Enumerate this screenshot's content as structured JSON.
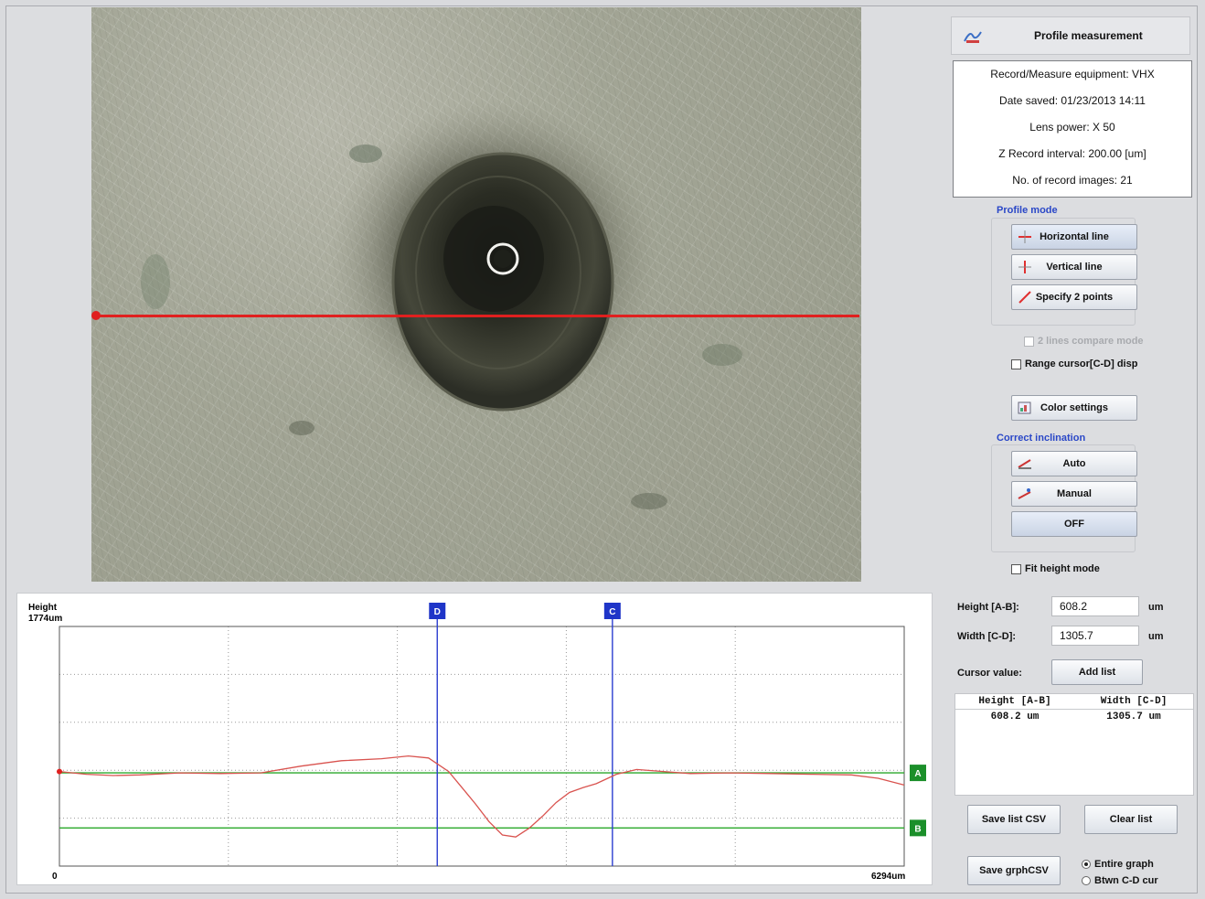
{
  "panel": {
    "title": "Profile measurement",
    "info": [
      "Record/Measure equipment: VHX",
      "Date saved: 01/23/2013 14:11",
      "Lens power: X 50",
      "Z Record interval: 200.00 [um]",
      "No. of record images: 21"
    ],
    "profile_mode_label": "Profile mode",
    "profile_mode_buttons": [
      "Horizontal line",
      "Vertical line",
      "Specify 2 points"
    ],
    "two_lines_compare": "2 lines compare mode",
    "range_cursor": "Range cursor[C-D] disp",
    "color_settings": "Color settings",
    "correct_inclination_label": "Correct inclination",
    "inclination_buttons": [
      "Auto",
      "Manual",
      "OFF"
    ],
    "fit_height": "Fit height mode"
  },
  "measure": {
    "height_label": "Height [A-B]:",
    "height_value": "608.2",
    "height_unit": "um",
    "width_label": "Width [C-D]:",
    "width_value": "1305.7",
    "width_unit": "um",
    "cursor_label": "Cursor value:",
    "add_list": "Add list",
    "list_headers": [
      "Height [A-B]",
      "Width [C-D]"
    ],
    "list_rows": [
      [
        "608.2 um",
        "1305.7 um"
      ]
    ],
    "save_list_csv": "Save list CSV",
    "clear_list": "Clear list",
    "save_graph_csv": "Save grphCSV",
    "radio_entire": "Entire graph",
    "radio_between": "Btwn C-D cur",
    "radio_selected": "entire"
  },
  "chart_data": {
    "type": "line",
    "y_label": "Height",
    "y_max_label": "1774um",
    "x_min_label": "0",
    "x_max_label": "6294um",
    "xlim": [
      0,
      6294
    ],
    "ylim": [
      0,
      1774
    ],
    "cursors": {
      "A": {
        "label": "A",
        "orientation": "horizontal",
        "y": 690
      },
      "B": {
        "label": "B",
        "orientation": "horizontal",
        "y": 282
      },
      "C": {
        "label": "D",
        "orientation": "vertical",
        "x": 2815
      },
      "D": {
        "label": "C",
        "orientation": "vertical",
        "x": 4120
      }
    },
    "colors": {
      "profile": "#d9534f",
      "cursor_h": "#29a829",
      "cursor_v": "#2c3ed0",
      "label_h": "#1b8f2a",
      "label_v": "#1f35c8"
    },
    "series": [
      {
        "x": [
          0,
          200,
          400,
          600,
          900,
          1200,
          1500,
          1800,
          2100,
          2400,
          2600,
          2750,
          2900,
          3000,
          3100,
          3200,
          3300,
          3400,
          3500,
          3600,
          3700,
          3800,
          3900,
          4000,
          4150,
          4300,
          4500,
          4700,
          5000,
          5300,
          5600,
          5900,
          6100,
          6294
        ],
        "y": [
          700,
          680,
          670,
          675,
          690,
          685,
          690,
          740,
          780,
          795,
          815,
          800,
          700,
          580,
          460,
          330,
          230,
          215,
          280,
          370,
          470,
          545,
          580,
          610,
          680,
          715,
          700,
          685,
          690,
          685,
          680,
          675,
          650,
          600
        ]
      }
    ]
  }
}
